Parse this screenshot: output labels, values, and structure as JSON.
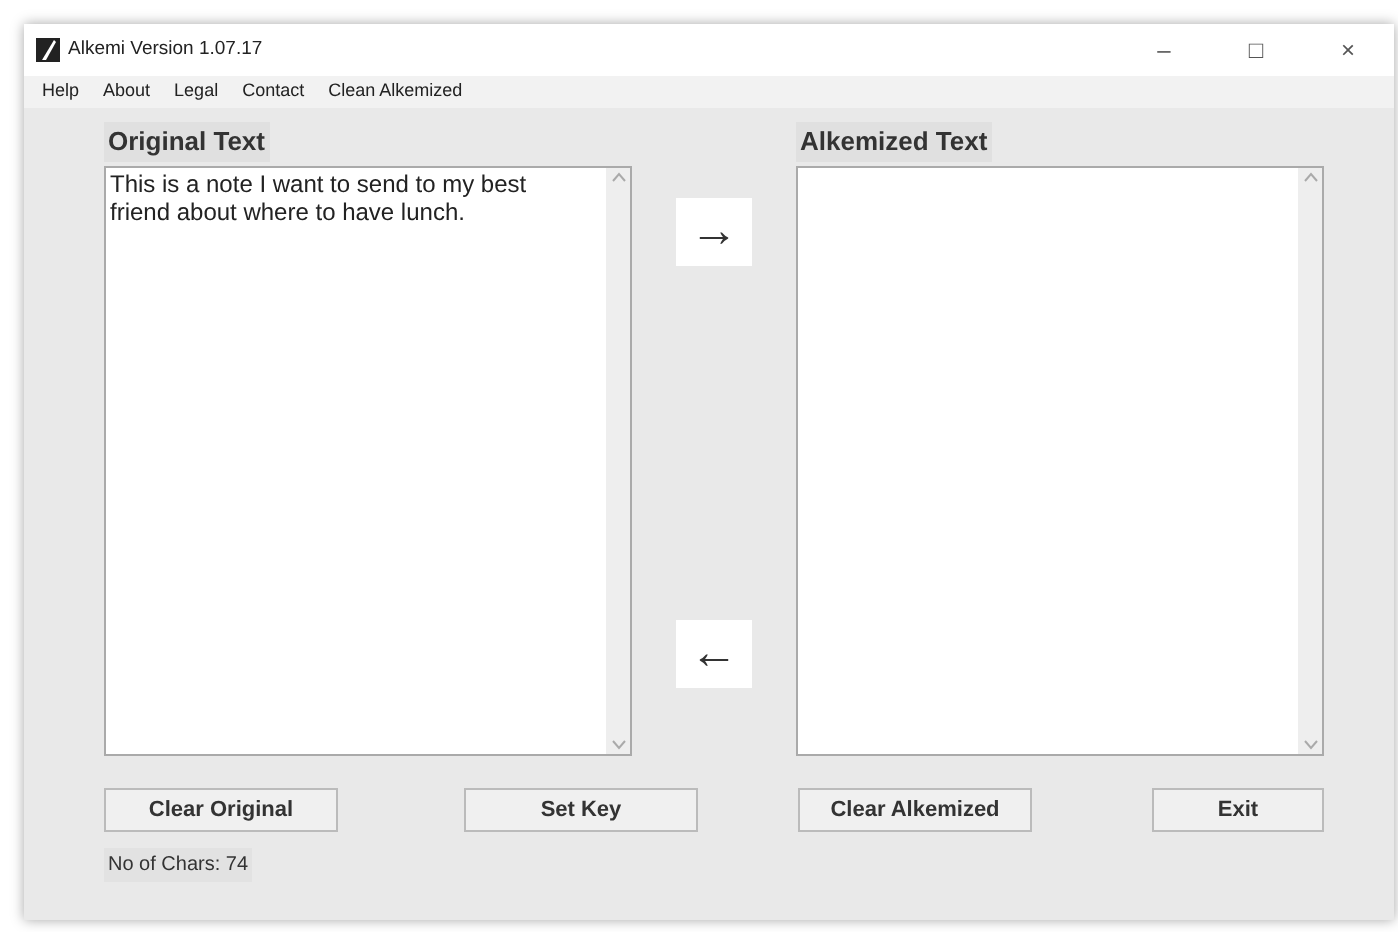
{
  "window": {
    "title": "Alkemi Version 1.07.17",
    "controls": [
      "–",
      "□",
      "×"
    ]
  },
  "menu": [
    "Help",
    "About",
    "Legal",
    "Contact",
    "Clean Alkemized"
  ],
  "original": {
    "label": "Original Text",
    "value": "This is a note I want to send to my best friend about where to have lunch."
  },
  "alkemized": {
    "label": "Alkemized Text"
  },
  "arrows": [
    "→",
    "←"
  ],
  "buttons": [
    "Clear Original",
    "Set Key",
    "Clear Alkemized",
    "Exit"
  ],
  "status": "No of Chars: 74"
}
